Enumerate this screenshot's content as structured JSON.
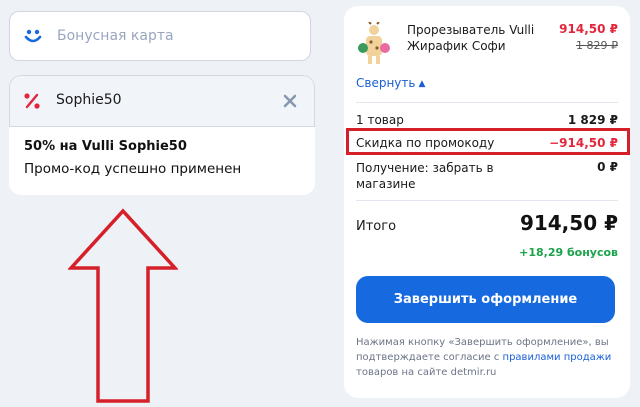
{
  "bonus": {
    "placeholder": "Бонусная карта"
  },
  "promo": {
    "code": "Sophie50",
    "title": "50% на Vulli Sophie50",
    "message": "Промо-код успешно применен"
  },
  "product": {
    "name": "Прорезыватель Vulli Жирафик Софи",
    "price_new": "914,50 ₽",
    "price_old": "1 829 ₽",
    "collapse_label": "Свернуть"
  },
  "summary": {
    "items_label": "1 товар",
    "items_value": "1 829 ₽",
    "discount_label": "Скидка по промокоду",
    "discount_value": "−914,50 ₽",
    "delivery_label": "Получение: забрать в магазине",
    "delivery_value": "0 ₽",
    "total_label": "Итого",
    "total_value": "914,50 ₽",
    "bonus_earn": "+18,29 бонусов"
  },
  "checkout": {
    "button_label": "Завершить оформление",
    "note_prefix": "Нажимая кнопку «Завершить оформление», вы подтверждаете согласие с ",
    "note_link": "правилами продажи",
    "note_suffix": " товаров на сайте detmir.ru"
  },
  "colors": {
    "accent": "#1769e0",
    "discount": "#e3263c",
    "bonus": "#1aa34a",
    "annotation": "#d5202a"
  },
  "icons": [
    "smile-icon",
    "percent-icon",
    "close-icon",
    "chevron-up-icon",
    "giraffe-toy-image",
    "up-arrow-annotation"
  ]
}
